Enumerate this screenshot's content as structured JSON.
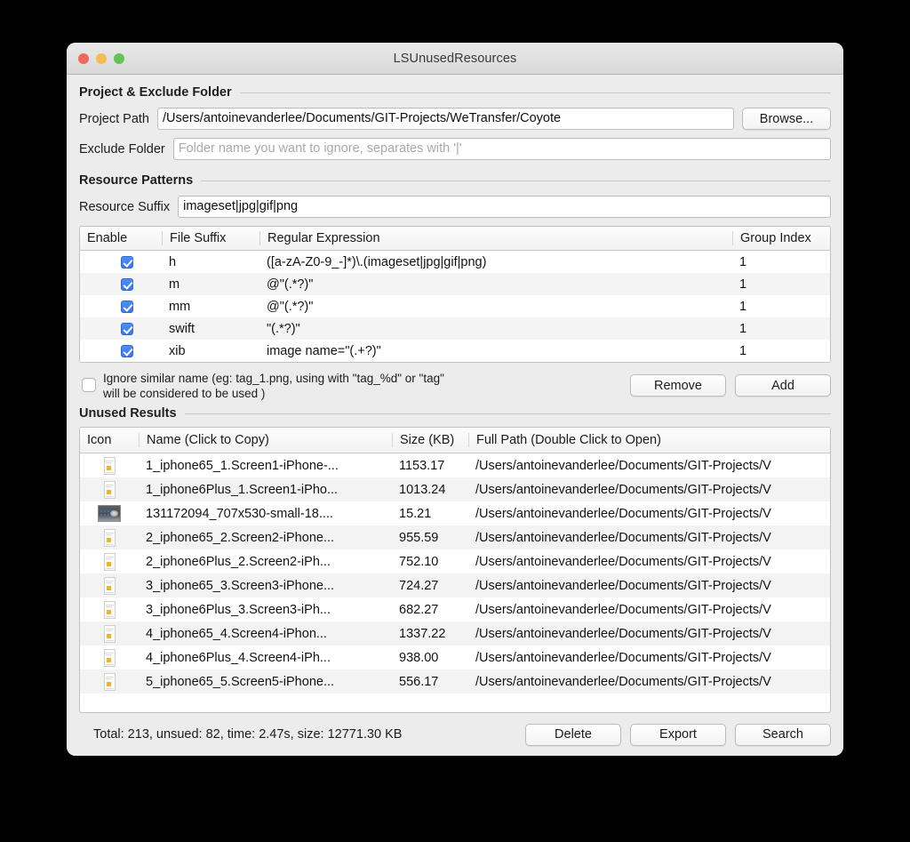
{
  "window": {
    "title": "LSUnusedResources",
    "traffic_lights": [
      "close-button",
      "minimize-button",
      "zoom-button"
    ]
  },
  "sections": {
    "project": {
      "title": "Project & Exclude Folder",
      "project_path_label": "Project Path",
      "project_path_value": "/Users/antoinevanderlee/Documents/GIT-Projects/WeTransfer/Coyote",
      "browse_label": "Browse...",
      "exclude_label": "Exclude Folder",
      "exclude_value": "",
      "exclude_placeholder": "Folder name you want to ignore, separates with '|'"
    },
    "patterns": {
      "title": "Resource Patterns",
      "suffix_label": "Resource Suffix",
      "suffix_value": "imageset|jpg|gif|png",
      "columns": [
        "Enable",
        "File Suffix",
        "Regular Expression",
        "Group Index"
      ],
      "rows": [
        {
          "enabled": true,
          "suffix": "h",
          "regex": "([a-zA-Z0-9_-]*)\\.(imageset|jpg|gif|png)",
          "group": "1"
        },
        {
          "enabled": true,
          "suffix": "m",
          "regex": "@\"(.*?)\"",
          "group": "1"
        },
        {
          "enabled": true,
          "suffix": "mm",
          "regex": "@\"(.*?)\"",
          "group": "1"
        },
        {
          "enabled": true,
          "suffix": "swift",
          "regex": "\"(.*?)\"",
          "group": "1"
        },
        {
          "enabled": true,
          "suffix": "xib",
          "regex": "image name=\"(.+?)\"",
          "group": "1"
        }
      ],
      "ignore_checked": false,
      "ignore_text_line1": "Ignore similar name (eg: tag_1.png, using with \"tag_%d\" or \"tag\"",
      "ignore_text_line2": "will be considered to be used )",
      "remove_label": "Remove",
      "add_label": "Add"
    },
    "results": {
      "title": "Unused Results",
      "columns": [
        "Icon",
        "Name (Click to Copy)",
        "Size (KB)",
        "Full Path (Double Click to Open)"
      ],
      "rows": [
        {
          "icon": "phone-screenshot-thumbnail",
          "name": "1_iphone65_1.Screen1-iPhone-...",
          "size": "1153.17",
          "path": "/Users/antoinevanderlee/Documents/GIT-Projects/V"
        },
        {
          "icon": "phone-screenshot-thumbnail",
          "name": "1_iphone6Plus_1.Screen1-iPho...",
          "size": "1013.24",
          "path": "/Users/antoinevanderlee/Documents/GIT-Projects/V"
        },
        {
          "icon": "landscape-photo-thumbnail",
          "name": "131172094_707x530-small-18....",
          "size": "15.21",
          "path": "/Users/antoinevanderlee/Documents/GIT-Projects/V"
        },
        {
          "icon": "phone-screenshot-thumbnail",
          "name": "2_iphone65_2.Screen2-iPhone...",
          "size": "955.59",
          "path": "/Users/antoinevanderlee/Documents/GIT-Projects/V"
        },
        {
          "icon": "phone-screenshot-thumbnail",
          "name": "2_iphone6Plus_2.Screen2-iPh...",
          "size": "752.10",
          "path": "/Users/antoinevanderlee/Documents/GIT-Projects/V"
        },
        {
          "icon": "phone-screenshot-thumbnail",
          "name": "3_iphone65_3.Screen3-iPhone...",
          "size": "724.27",
          "path": "/Users/antoinevanderlee/Documents/GIT-Projects/V"
        },
        {
          "icon": "phone-screenshot-thumbnail",
          "name": "3_iphone6Plus_3.Screen3-iPh...",
          "size": "682.27",
          "path": "/Users/antoinevanderlee/Documents/GIT-Projects/V"
        },
        {
          "icon": "phone-screenshot-thumbnail",
          "name": "4_iphone65_4.Screen4-iPhon...",
          "size": "1337.22",
          "path": "/Users/antoinevanderlee/Documents/GIT-Projects/V"
        },
        {
          "icon": "phone-screenshot-thumbnail",
          "name": "4_iphone6Plus_4.Screen4-iPh...",
          "size": "938.00",
          "path": "/Users/antoinevanderlee/Documents/GIT-Projects/V"
        },
        {
          "icon": "phone-screenshot-thumbnail",
          "name": "5_iphone65_5.Screen5-iPhone...",
          "size": "556.17",
          "path": "/Users/antoinevanderlee/Documents/GIT-Projects/V"
        }
      ]
    }
  },
  "statusbar": {
    "text": "Total: 213, unsued: 82, time: 2.47s, size: 12771.30 KB",
    "delete_label": "Delete",
    "export_label": "Export",
    "search_label": "Search"
  },
  "colors": {
    "window_background": "#ececec",
    "checkbox_accent": "#3a77ef",
    "traffic_red": "#ed6a5e",
    "traffic_yellow": "#f4bd4f",
    "traffic_green": "#61c454"
  }
}
